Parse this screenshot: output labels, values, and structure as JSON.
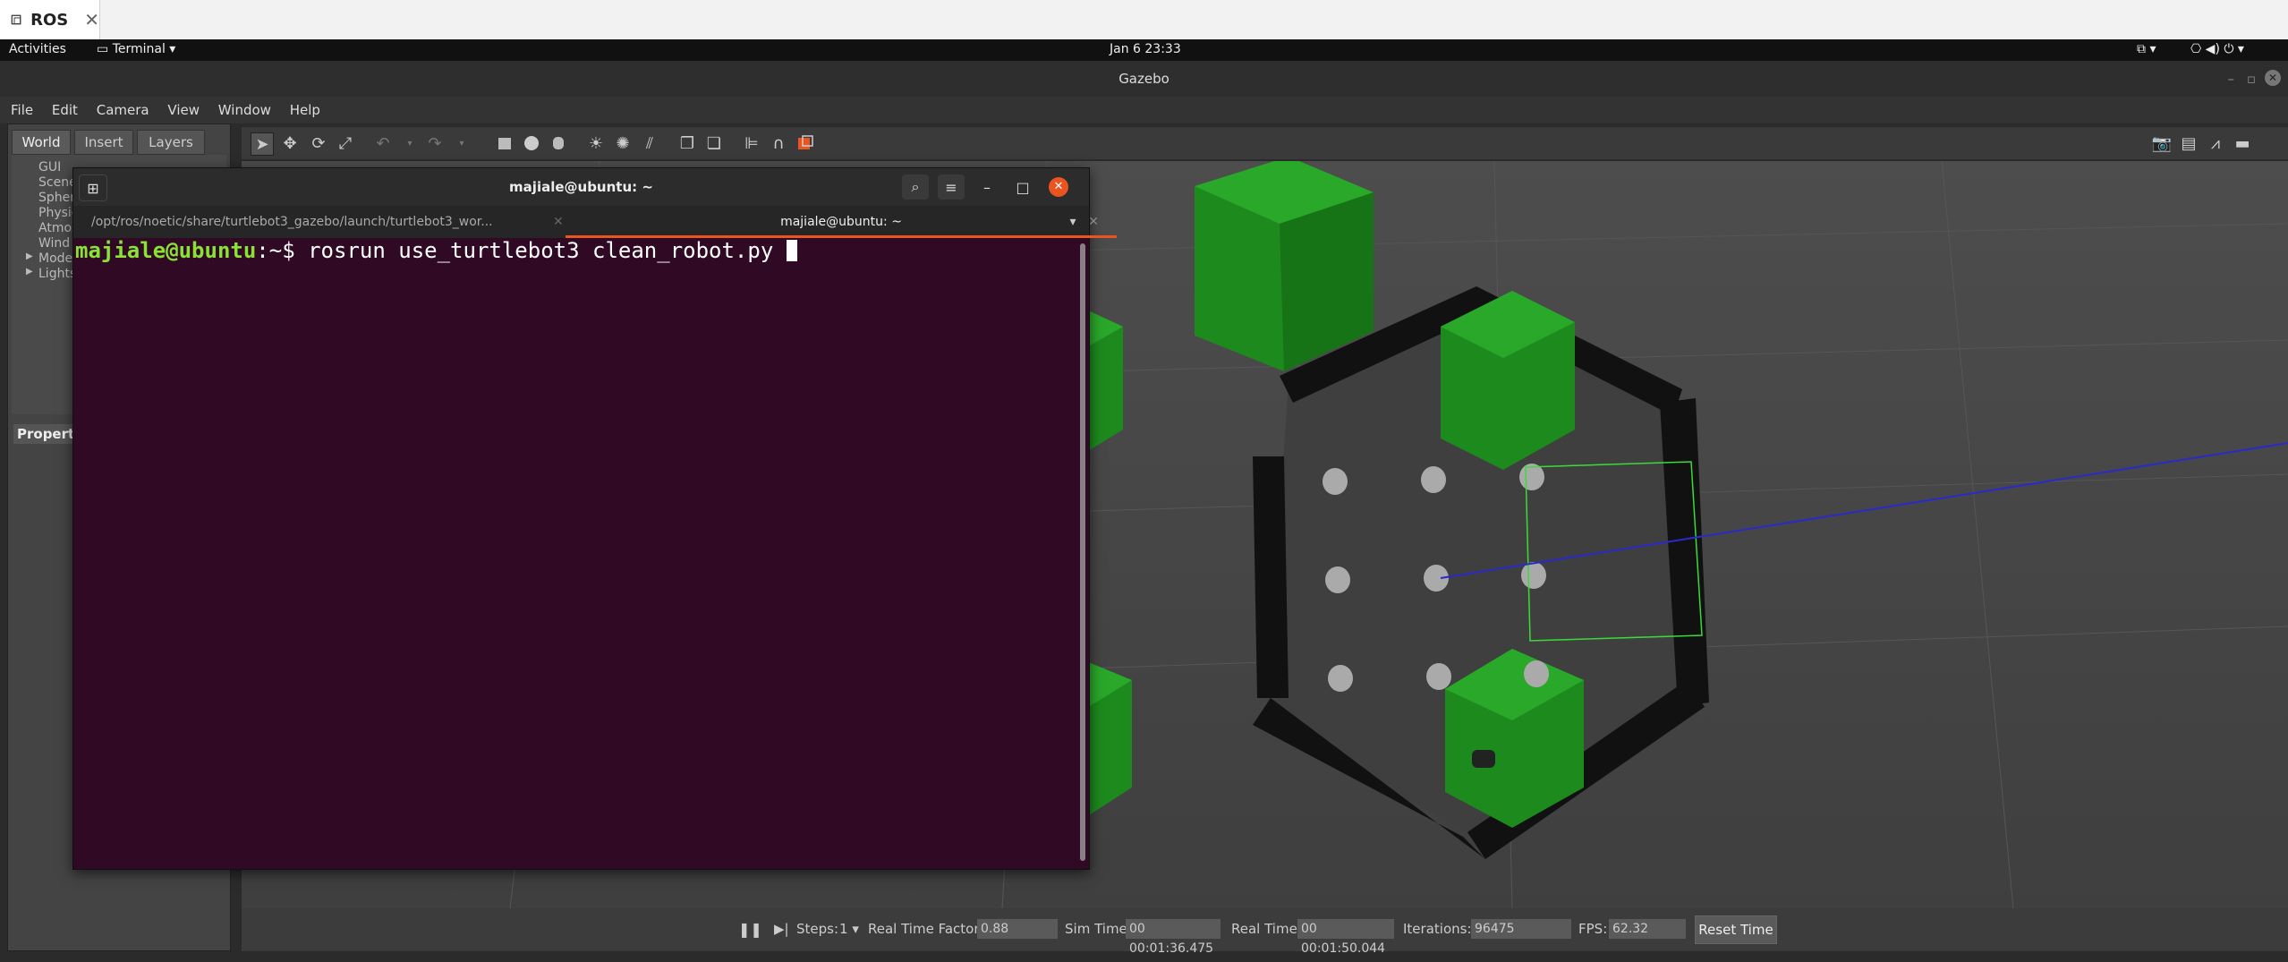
{
  "outer_tab": {
    "label": "ROS",
    "close": "✕"
  },
  "topbar": {
    "activities": "Activities",
    "app_menu": "Terminal",
    "clock": "Jan 6  23:33"
  },
  "gazebo": {
    "title": "Gazebo",
    "menu": [
      "File",
      "Edit",
      "Camera",
      "View",
      "Window",
      "Help"
    ],
    "left_tabs": [
      "World",
      "Insert",
      "Layers"
    ],
    "tree": [
      "GUI",
      "Scene",
      "Spheri",
      "Physic",
      "Atmos",
      "Wind",
      "Model",
      "Lights"
    ],
    "property_label": "Property",
    "bottom": {
      "steps_label": "Steps:",
      "steps_value": "1",
      "rtf_label": "Real Time Factor:",
      "rtf_value": "0.88",
      "sim_time_label": "Sim Time:",
      "sim_time_value": "00 00:01:36.475",
      "real_time_label": "Real Time:",
      "real_time_value": "00 00:01:50.044",
      "iterations_label": "Iterations:",
      "iterations_value": "96475",
      "fps_label": "FPS:",
      "fps_value": "62.32",
      "reset_label": "Reset Time"
    }
  },
  "terminal": {
    "title": "majiale@ubuntu: ~",
    "tabs": [
      {
        "label": "/opt/ros/noetic/share/turtlebot3_gazebo/launch/turtlebot3_wor...",
        "active": false
      },
      {
        "label": "majiale@ubuntu: ~",
        "active": true
      }
    ],
    "prompt_user": "majiale@ubuntu",
    "prompt_sep": ":~$",
    "command": "rosrun use_turtlebot3 clean_robot.py"
  },
  "colors": {
    "terminal_bg": "#300a24",
    "prompt_green": "#8ae234",
    "accent_orange": "#e95420",
    "cube_green": "#1f8f1f"
  }
}
